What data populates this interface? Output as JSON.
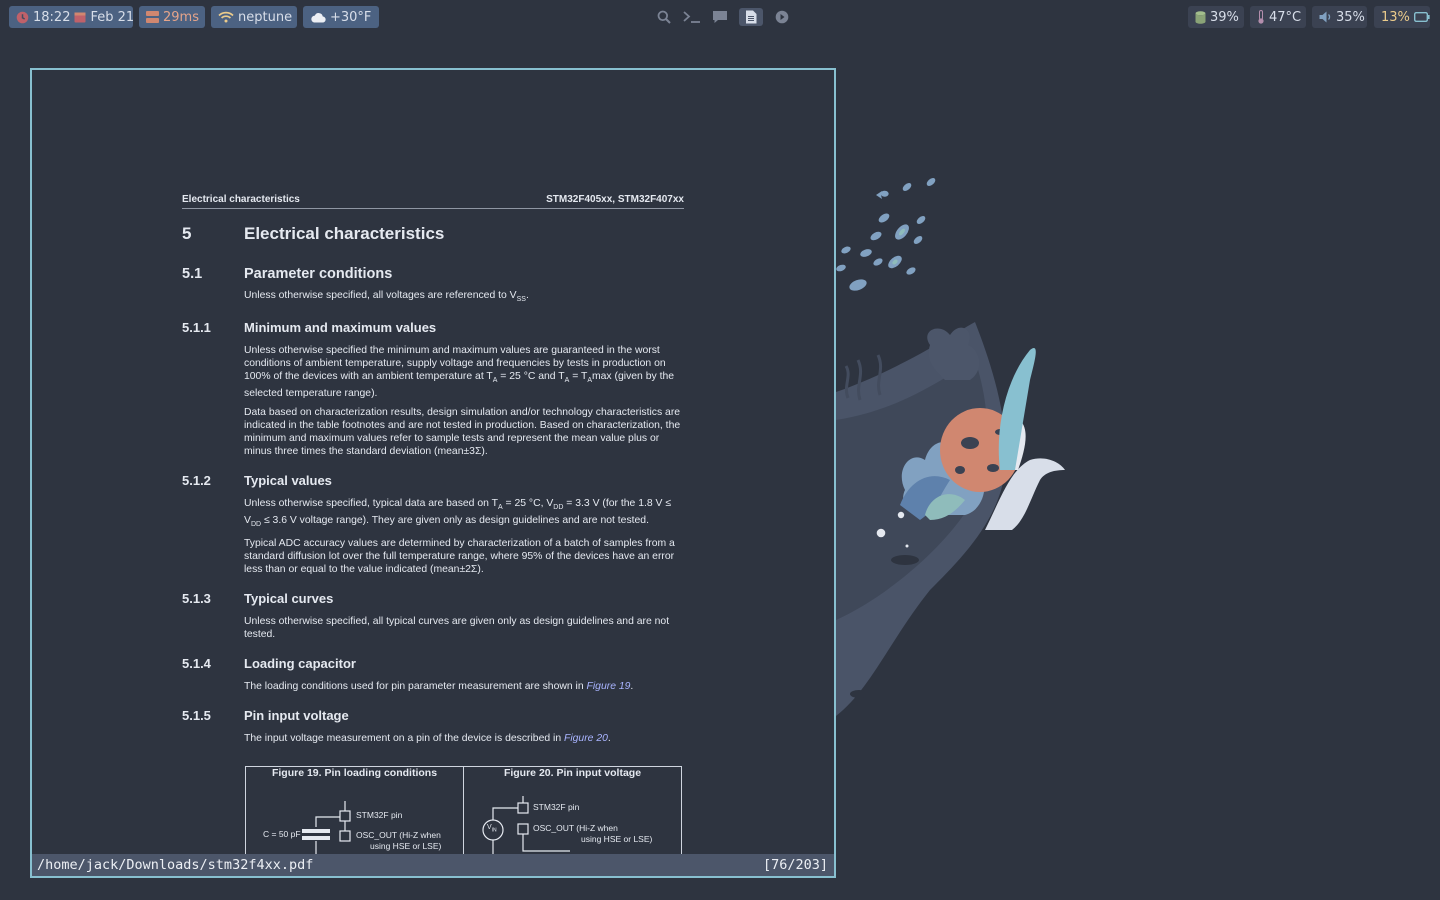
{
  "topbar": {
    "clock": {
      "time": "18:22",
      "date": "Feb 21"
    },
    "latency": "29ms",
    "network": "neptune",
    "weather": "+30°F",
    "center_icons": [
      "search-icon",
      "terminal-icon",
      "chat-icon",
      "document-icon",
      "play-icon"
    ],
    "disk": "39%",
    "temperature": "47°C",
    "volume": "35%",
    "battery": "13%",
    "colors": {
      "pill": "#434c5e",
      "accent": "#4c6282",
      "clock_icon": "#bf616a",
      "battery_text": "#ebcb8b"
    }
  },
  "pdf": {
    "header_left": "Electrical characteristics",
    "header_right": "STM32F405xx, STM32F407xx",
    "section": {
      "num": "5",
      "title": "Electrical characteristics"
    },
    "s51": {
      "num": "5.1",
      "title": "Parameter conditions",
      "text": "Unless otherwise specified, all voltages are referenced to V",
      "sub": "SS",
      "tail": "."
    },
    "s511": {
      "num": "5.1.1",
      "title": "Minimum and maximum values",
      "p1": {
        "a": "Unless otherwise specified the minimum and maximum values are guaranteed in the worst conditions of ambient temperature, supply voltage and frequencies by tests in production on 100% of the devices with an ambient temperature at T",
        "s1": "A",
        "b": " = 25 °C and T",
        "s2": "A",
        "c": " = T",
        "s3": "A",
        "d": "max (given by the selected temperature range)."
      },
      "p2": "Data based on characterization results, design simulation and/or technology characteristics are indicated in the table footnotes and are not tested in production. Based on characterization, the minimum and maximum values refer to sample tests and represent the mean value plus or minus three times the standard deviation (mean±3Σ)."
    },
    "s512": {
      "num": "5.1.2",
      "title": "Typical values",
      "p1": {
        "a": "Unless otherwise specified, typical data are based on T",
        "s1": "A",
        "b": " = 25 °C, V",
        "s2": "DD",
        "c": " = 3.3 V (for the 1.8 V ≤ V",
        "s3": "DD",
        "d": " ≤ 3.6 V voltage range). They are given only as design guidelines and are not tested."
      },
      "p2": "Typical ADC accuracy values are determined by characterization of a batch of samples from a standard diffusion lot over the full temperature range, where 95% of the devices have an error less than or equal to the value indicated (mean±2Σ)."
    },
    "s513": {
      "num": "5.1.3",
      "title": "Typical curves",
      "text": "Unless otherwise specified, all typical curves are given only as design guidelines and are not tested."
    },
    "s514": {
      "num": "5.1.4",
      "title": "Loading capacitor",
      "text": "The loading conditions used for pin parameter measurement are shown in ",
      "link": "Figure 19",
      "tail": "."
    },
    "s515": {
      "num": "5.1.5",
      "title": "Pin input voltage",
      "text": "The input voltage measurement on a pin of the device is described in ",
      "link": "Figure 20",
      "tail": "."
    },
    "fig19": {
      "title": "Figure 19. Pin loading conditions",
      "pin": "STM32F pin",
      "cap": "C = 50 pF",
      "osc": "OSC_OUT (Hi-Z when",
      "osc2": "using HSE or LSE)"
    },
    "fig20": {
      "title": "Figure 20. Pin input voltage",
      "pin": "STM32F pin",
      "vin": "V",
      "vin_sub": "IN",
      "osc": "OSC_OUT (Hi-Z when",
      "osc2": "using HSE or LSE)"
    },
    "status_path": "/home/jack/Downloads/stm32f4xx.pdf",
    "status_page": "[76/203]"
  }
}
